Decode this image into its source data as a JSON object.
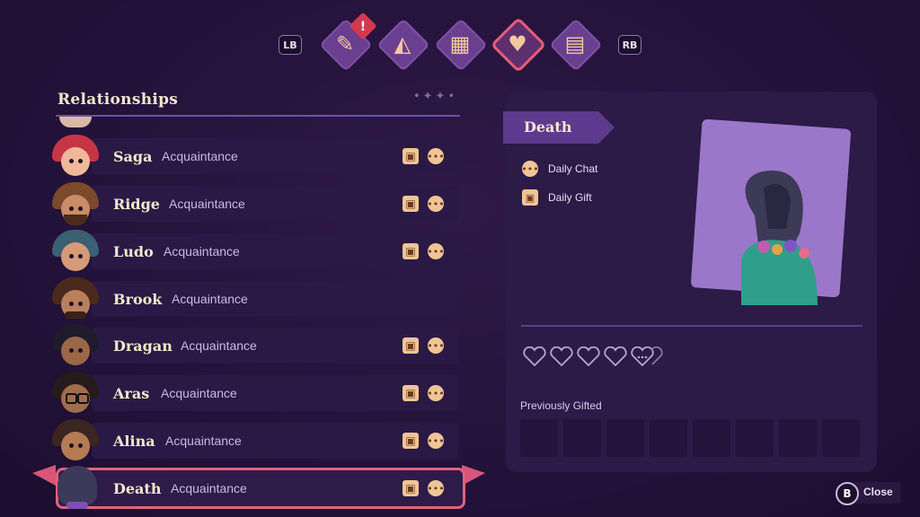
{
  "tabs": {
    "left_shoulder": "LB",
    "right_shoulder": "RB",
    "alert_mark": "!",
    "items": [
      {
        "icon": "quest-scroll-icon",
        "active": false,
        "alert": true
      },
      {
        "icon": "map-icon",
        "active": false,
        "alert": false
      },
      {
        "icon": "calendar-icon",
        "active": false,
        "alert": false
      },
      {
        "icon": "heart-icon",
        "active": true,
        "alert": false
      },
      {
        "icon": "book-icon",
        "active": false,
        "alert": false
      }
    ]
  },
  "relationships": {
    "title": "Relationships",
    "rows": [
      {
        "name": "Saga",
        "status": "Acquaintance",
        "gift": true,
        "chat": true
      },
      {
        "name": "Ridge",
        "status": "Acquaintance",
        "gift": true,
        "chat": true
      },
      {
        "name": "Ludo",
        "status": "Acquaintance",
        "gift": true,
        "chat": true
      },
      {
        "name": "Brook",
        "status": "Acquaintance",
        "gift": false,
        "chat": false
      },
      {
        "name": "Dragan",
        "status": "Acquaintance",
        "gift": true,
        "chat": true
      },
      {
        "name": "Aras",
        "status": "Acquaintance",
        "gift": true,
        "chat": true
      },
      {
        "name": "Alina",
        "status": "Acquaintance",
        "gift": true,
        "chat": true
      },
      {
        "name": "Death",
        "status": "Acquaintance",
        "gift": true,
        "chat": true,
        "selected": true
      }
    ]
  },
  "detail": {
    "name": "Death",
    "tasks": [
      {
        "icon": "chat-icon",
        "label": "Daily Chat"
      },
      {
        "icon": "gift-icon",
        "label": "Daily Gift"
      }
    ],
    "hearts_filled": 0,
    "hearts_total": 5,
    "previously_gifted_label": "Previously Gifted",
    "gift_slots": 8
  },
  "footer": {
    "close_key": "B",
    "close_label": "Close"
  },
  "colors": {
    "accent_pink": "#e0637c",
    "tab_purple": "#6a3f8f",
    "gift_peach": "#f0c595"
  }
}
